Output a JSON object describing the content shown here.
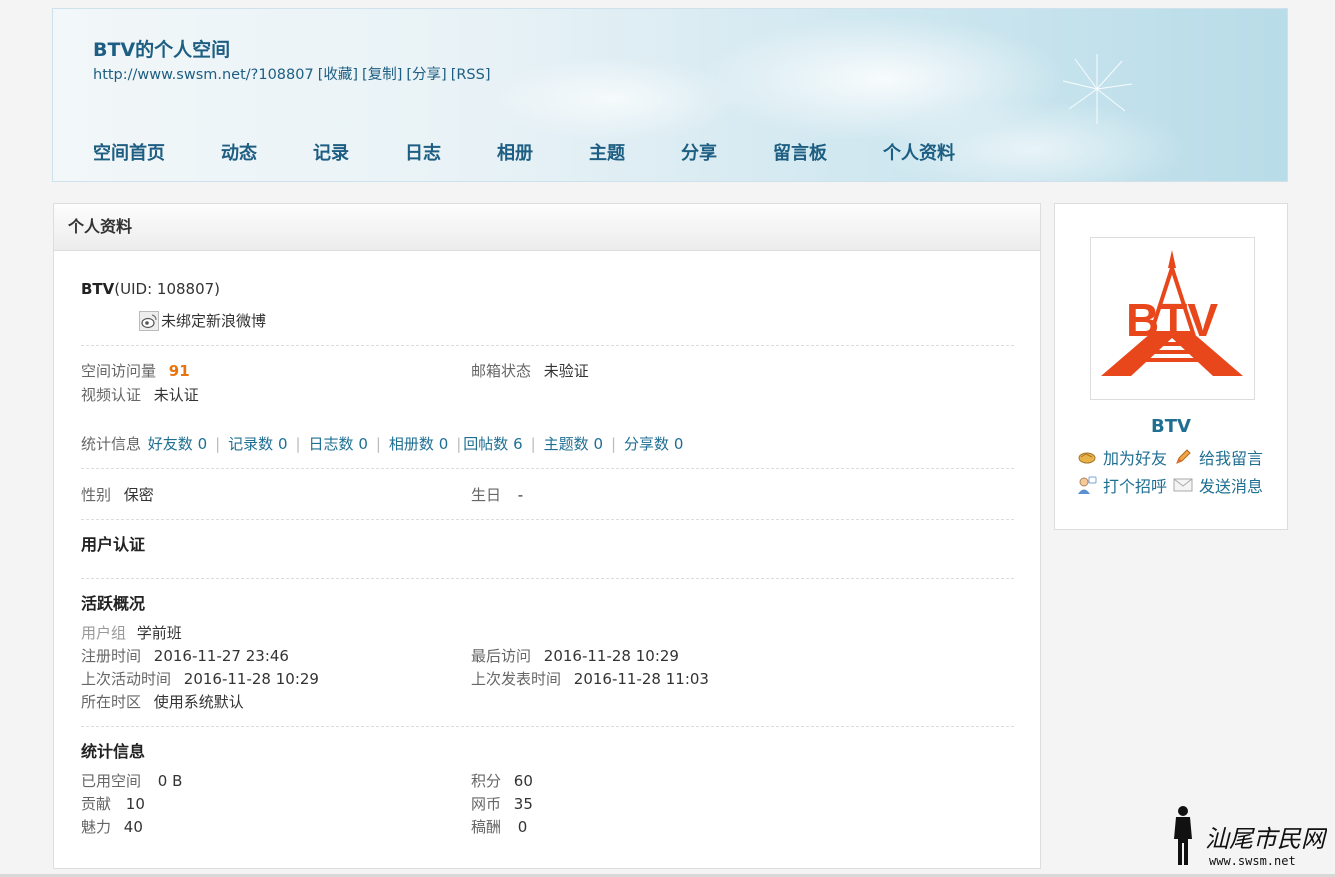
{
  "header": {
    "title": "BTV的个人空间",
    "url": "http://www.swsm.net/?108807",
    "links": [
      "[收藏]",
      "[复制]",
      "[分享]",
      "[RSS]"
    ],
    "nav": [
      "空间首页",
      "动态",
      "记录",
      "日志",
      "相册",
      "主题",
      "分享",
      "留言板",
      "个人资料"
    ]
  },
  "panel": {
    "title": "个人资料",
    "username": "BTV",
    "uid": "(UID: 108807)",
    "weibo": "未绑定新浪微博",
    "visits_label": "空间访问量",
    "visits_value": "91",
    "email_label": "邮箱状态",
    "email_value": "未验证",
    "video_label": "视频认证",
    "video_value": "未认证",
    "stats_label": "统计信息",
    "stats": [
      "好友数 0",
      "记录数 0",
      "日志数 0",
      "相册数 0",
      "回帖数 6",
      "主题数 0",
      "分享数 0"
    ],
    "gender_label": "性别",
    "gender_value": "保密",
    "birthday_label": "生日",
    "birthday_value": "-",
    "cert_title": "用户认证",
    "activity_title": "活跃概况",
    "group_label": "用户组",
    "group_value": "学前班",
    "reg_label": "注册时间",
    "reg_value": "2016-11-27 23:46",
    "last_visit_label": "最后访问",
    "last_visit_value": "2016-11-28 10:29",
    "last_active_label": "上次活动时间",
    "last_active_value": "2016-11-28 10:29",
    "last_post_label": "上次发表时间",
    "last_post_value": "2016-11-28 11:03",
    "tz_label": "所在时区",
    "tz_value": "使用系统默认",
    "stat_title": "统计信息",
    "space_label": "已用空间",
    "space_value": "0 B",
    "points_label": "积分",
    "points_value": "60",
    "contrib_label": "贡献",
    "contrib_value": "10",
    "coin_label": "网币",
    "coin_value": "35",
    "charm_label": "魅力",
    "charm_value": "40",
    "fee_label": "稿酬",
    "fee_value": "0"
  },
  "sidebar": {
    "name": "BTV",
    "logo_text": "BTV",
    "add_friend": "加为好友",
    "leave_msg": "给我留言",
    "greet": "打个招呼",
    "send_msg": "发送消息"
  },
  "watermark": {
    "title": "汕尾市民网",
    "url": "www.swsm.net"
  },
  "colors": {
    "link": "#1f6f93",
    "accent": "#e8730c",
    "logo": "#e8471c"
  }
}
